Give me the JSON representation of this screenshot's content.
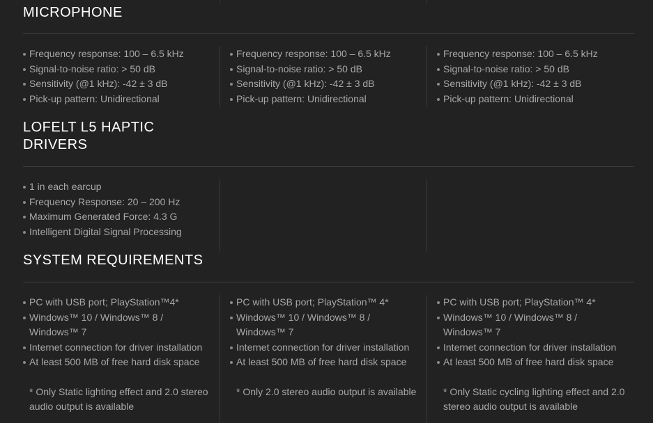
{
  "microphone": {
    "title": "MICROPHONE",
    "columns": [
      [
        "Frequency response: 100 – 6.5 kHz",
        "Signal-to-noise ratio: > 50 dB",
        "Sensitivity (@1  kHz): -42 ± 3 dB",
        "Pick-up pattern: Unidirectional"
      ],
      [
        "Frequency response: 100 – 6.5 kHz",
        "Signal-to-noise ratio: > 50 dB",
        "Sensitivity (@1 kHz): -42 ± 3 dB",
        "Pick-up pattern: Unidirectional"
      ],
      [
        "Frequency response: 100 – 6.5 kHz",
        "Signal-to-noise ratio: > 50 dB",
        "Sensitivity (@1 kHz): -42 ± 3 dB",
        "Pick-up pattern: Unidirectional"
      ]
    ]
  },
  "haptic": {
    "title_line1": "LOFELT L5 HAPTIC",
    "title_line2": "DRIVERS",
    "columns": [
      [
        "1 in each earcup",
        "Frequency Response: 20 – 200 Hz",
        "Maximum Generated Force: 4.3 G",
        "Intelligent Digital Signal Processing"
      ]
    ]
  },
  "system": {
    "title": "SYSTEM REQUIREMENTS",
    "columns": [
      [
        "PC with USB port; PlayStation™4*",
        "Windows™ 10 / Windows™ 8 / Windows™ 7",
        "Internet connection for driver installation",
        "At least 500 MB of free hard disk space"
      ],
      [
        "PC with USB port; PlayStation™ 4*",
        "Windows™ 10 / Windows™ 8 / Windows™ 7",
        "Internet connection for driver installation",
        "At least 500 MB of free hard disk space"
      ],
      [
        "PC with USB port; PlayStation™ 4*",
        "Windows™ 10 / Windows™ 8 / Windows™ 7",
        "Internet connection for driver installation",
        "At least 500 MB of free hard disk space"
      ]
    ],
    "notes": [
      "* Only Static lighting effect and 2.0 stereo audio output is available",
      "* Only 2.0 stereo audio output is available",
      "* Only Static cycling lighting effect and 2.0 stereo audio output is available"
    ]
  }
}
